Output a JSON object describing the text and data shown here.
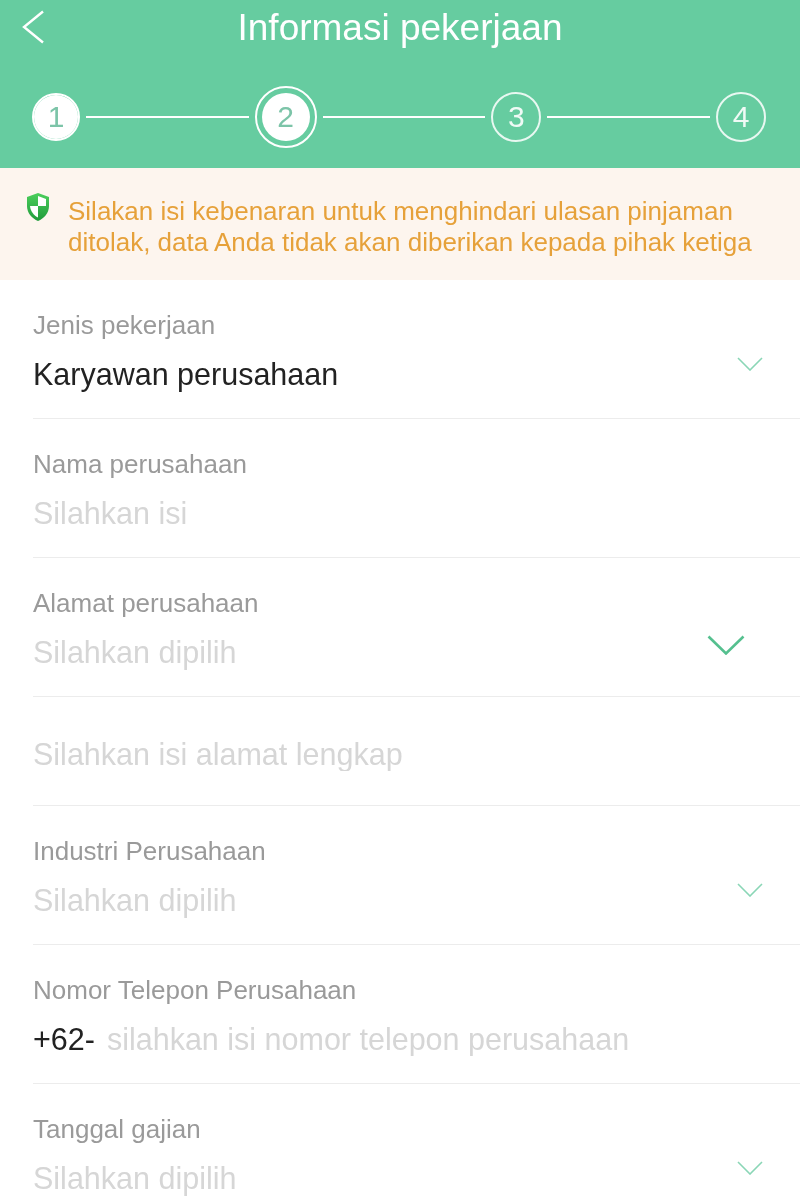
{
  "header": {
    "title": "Informasi pekerjaan"
  },
  "steps": [
    {
      "number": "1",
      "reached": true,
      "selected": false
    },
    {
      "number": "2",
      "reached": true,
      "selected": true
    },
    {
      "number": "3",
      "reached": false,
      "selected": false
    },
    {
      "number": "4",
      "reached": false,
      "selected": false
    }
  ],
  "notice": {
    "text": "Silakan isi kebenaran untuk menghindari ulasan pinjaman ditolak, data Anda tidak akan diberikan kepada pihak ketiga"
  },
  "fields": [
    {
      "kind": "select",
      "label": "Jenis pekerjaan",
      "value": "Karyawan perusahaan",
      "active": false
    },
    {
      "kind": "text",
      "label": "Nama perusahaan",
      "placeholder": "Silahkan isi"
    },
    {
      "kind": "select",
      "label": "Alamat perusahaan",
      "placeholder": "Silahkan dipilih",
      "active": true
    },
    {
      "kind": "text",
      "placeholder": "Silahkan isi alamat lengkap"
    },
    {
      "kind": "select",
      "label": "Industri Perusahaan",
      "placeholder": "Silahkan dipilih",
      "active": false
    },
    {
      "kind": "phone",
      "label": "Nomor Telepon Perusahaan",
      "prefix": "+62-",
      "placeholder": "silahkan isi nomor telepon perusahaan"
    },
    {
      "kind": "select",
      "label": "Tanggal gajian",
      "placeholder": "Silahkan dipilih",
      "active": false
    }
  ]
}
